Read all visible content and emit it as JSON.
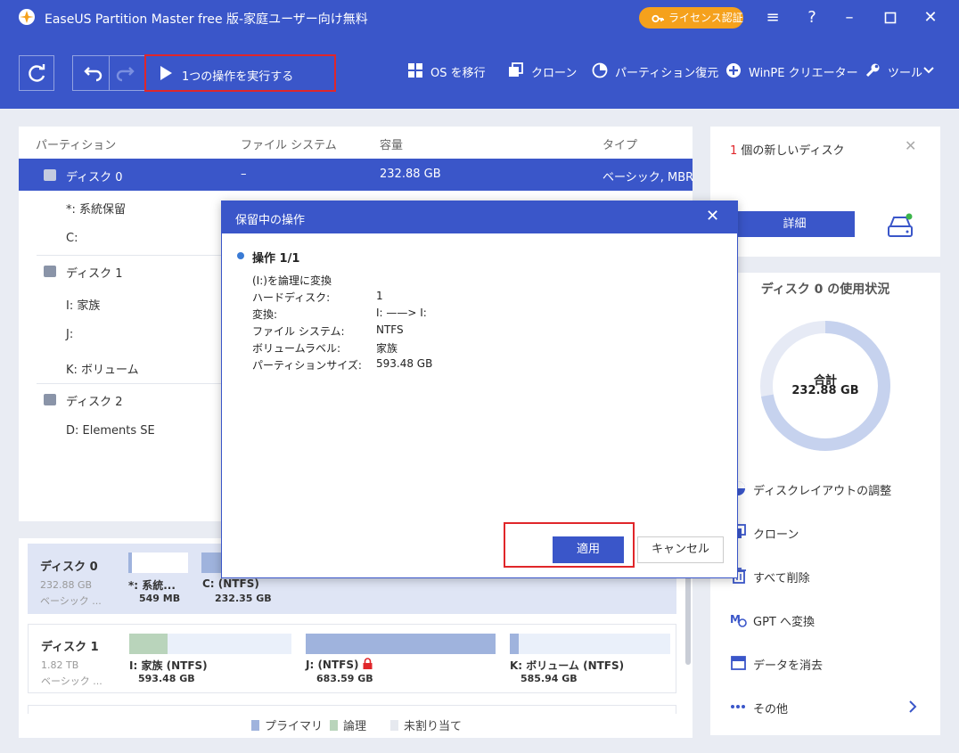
{
  "titlebar": {
    "title": "EaseUS Partition Master free 版-家庭ユーザー向け無料",
    "license_label": "ライセンス認証",
    "license_color": "#f5a11c"
  },
  "toolbar": {
    "execute_label": "1つの操作を実行する",
    "items": [
      {
        "label": "OS を移行",
        "icon": "windows-icon"
      },
      {
        "label": "クローン",
        "icon": "clone-icon"
      },
      {
        "label": "パーティション復元",
        "icon": "pie-icon"
      },
      {
        "label": "WinPE クリエーター",
        "icon": "plus-circle-icon"
      },
      {
        "label": "ツール",
        "icon": "wrench-icon"
      }
    ]
  },
  "partition_table": {
    "headers": [
      "パーティション",
      "ファイル システム",
      "容量",
      "タイプ"
    ],
    "rows": [
      {
        "name": "ディスク 0",
        "fs": "–",
        "capacity": "232.88 GB",
        "type": "ベーシック, MBR",
        "is_disk": true
      },
      {
        "name": "*: 系統保留",
        "is_disk": false
      },
      {
        "name": "C:",
        "is_disk": false
      },
      {
        "name": "ディスク 1",
        "is_disk": true
      },
      {
        "name": "I: 家族",
        "is_disk": false
      },
      {
        "name": "J:",
        "is_disk": false
      },
      {
        "name": "K: ボリューム",
        "is_disk": false
      },
      {
        "name": "ディスク 2",
        "is_disk": true
      },
      {
        "name": "D: Elements SE",
        "is_disk": false
      }
    ]
  },
  "diskmap": {
    "disks": [
      {
        "name": "ディスク 0",
        "size": "232.88 GB",
        "type": "ベーシック ...",
        "partitions": [
          {
            "label": "*: 系統...",
            "size": "549 MB"
          },
          {
            "label": "C: (NTFS)",
            "size": "232.35 GB"
          }
        ]
      },
      {
        "name": "ディスク 1",
        "size": "1.82 TB",
        "type": "ベーシック ...",
        "partitions": [
          {
            "label": "I: 家族 (NTFS)",
            "size": "593.48 GB"
          },
          {
            "label": "J: (NTFS)",
            "size": "683.59 GB"
          },
          {
            "label": "K: ボリューム (NTFS)",
            "size": "585.94 GB"
          }
        ]
      }
    ],
    "legend": [
      "プライマリ",
      "論理",
      "未割り当て"
    ]
  },
  "right_panel": {
    "new_disk_count": "1",
    "new_disk_text": " 個の新しいディスク",
    "details_label": "詳細",
    "usage_title": "ディスク 0 の使用状況",
    "total_label": "合計",
    "total_value": "232.88 GB",
    "actions": [
      {
        "label": "ディスクレイアウトの調整",
        "icon": "layout-icon"
      },
      {
        "label": "クローン",
        "icon": "clone-icon"
      },
      {
        "label": "すべて削除",
        "icon": "trash-icon"
      },
      {
        "label": "GPT へ変換",
        "icon": "convert-icon"
      },
      {
        "label": "データを消去",
        "icon": "erase-icon"
      },
      {
        "label": "その他",
        "icon": "more-icon"
      }
    ]
  },
  "dialog": {
    "title": "保留中の操作",
    "op_title": "操作 1/1",
    "op_desc": "(I:)を論理に変換",
    "fields": [
      {
        "k": "ハードディスク:",
        "v": "1"
      },
      {
        "k": "変換:",
        "v": "I: ——> I:"
      },
      {
        "k": "ファイル システム:",
        "v": "NTFS"
      },
      {
        "k": "ボリュームラベル:",
        "v": "家族"
      },
      {
        "k": "パーティションサイズ:",
        "v": "593.48 GB"
      }
    ],
    "apply_label": "適用",
    "cancel_label": "キャンセル"
  }
}
